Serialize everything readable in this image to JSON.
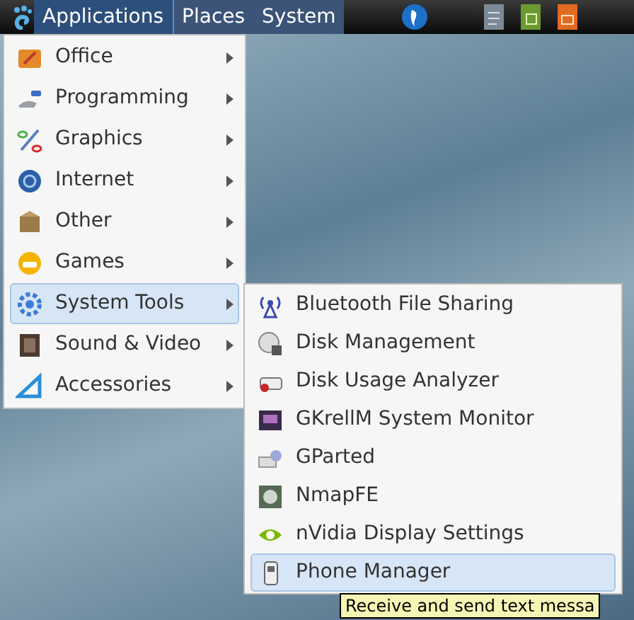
{
  "panel": {
    "menus": [
      {
        "label": "Applications",
        "selected": true
      },
      {
        "label": "Places",
        "selected": false
      },
      {
        "label": "System",
        "selected": false
      }
    ]
  },
  "applications_menu": {
    "items": [
      {
        "label": "Office",
        "selected": false
      },
      {
        "label": "Programming",
        "selected": false
      },
      {
        "label": "Graphics",
        "selected": false
      },
      {
        "label": "Internet",
        "selected": false
      },
      {
        "label": "Other",
        "selected": false
      },
      {
        "label": "Games",
        "selected": false
      },
      {
        "label": "System Tools",
        "selected": true
      },
      {
        "label": "Sound & Video",
        "selected": false
      },
      {
        "label": "Accessories",
        "selected": false
      }
    ]
  },
  "system_tools_menu": {
    "items": [
      {
        "label": "Bluetooth File Sharing",
        "selected": false
      },
      {
        "label": "Disk Management",
        "selected": false
      },
      {
        "label": "Disk Usage Analyzer",
        "selected": false
      },
      {
        "label": "GKrellM System Monitor",
        "selected": false
      },
      {
        "label": "GParted",
        "selected": false
      },
      {
        "label": "NmapFE",
        "selected": false
      },
      {
        "label": "nVidia Display Settings",
        "selected": false
      },
      {
        "label": "Phone Manager",
        "selected": true
      }
    ]
  },
  "tooltip": "Receive and send text messa"
}
